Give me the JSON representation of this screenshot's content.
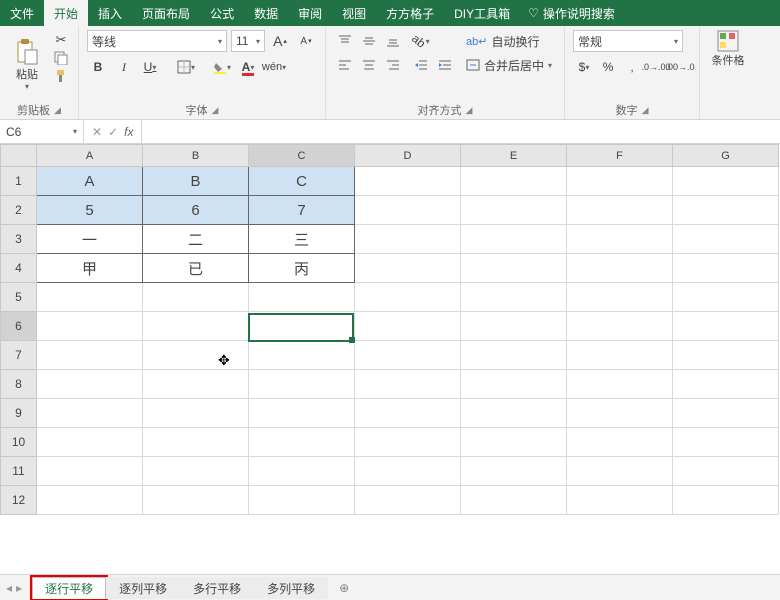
{
  "tabs": {
    "file": "文件",
    "home": "开始",
    "insert": "插入",
    "layout": "页面布局",
    "formulas": "公式",
    "data": "数据",
    "review": "审阅",
    "view": "视图",
    "fanggezi": "方方格子",
    "diy": "DIY工具箱",
    "helpsearch": "操作说明搜索"
  },
  "ribbon": {
    "clipboard": {
      "label": "剪贴板",
      "paste": "粘贴"
    },
    "font": {
      "label": "字体",
      "name": "等线",
      "size": "11",
      "increase": "A",
      "decrease": "A",
      "bold": "B",
      "italic": "I",
      "underline": "U"
    },
    "align": {
      "label": "对齐方式",
      "wrap": "自动换行",
      "merge": "合并后居中"
    },
    "number": {
      "label": "数字",
      "format": "常规"
    },
    "cf": "条件格"
  },
  "namebox": "C6",
  "columns": [
    "A",
    "B",
    "C",
    "D",
    "E",
    "F",
    "G"
  ],
  "rows": [
    1,
    2,
    3,
    4,
    5,
    6,
    7,
    8,
    9,
    10,
    11,
    12
  ],
  "cells": {
    "A1": "A",
    "B1": "B",
    "C1": "C",
    "A2": "5",
    "B2": "6",
    "C2": "7",
    "A3": "一",
    "B3": "二",
    "C3": "三",
    "A4": "甲",
    "B4": "已",
    "C4": "丙"
  },
  "selected_range": [
    "A1",
    "C2"
  ],
  "active_cell": "C6",
  "cursor_at": {
    "row": 7,
    "col": "B"
  },
  "sheet_tabs": {
    "t1": "逐行平移",
    "t2": "逐列平移",
    "t3": "多行平移",
    "t4": "多列平移"
  },
  "active_sheet": "t1",
  "colors": {
    "brand": "#217346",
    "accent": "#e80000",
    "sel": "#cfe2f3"
  }
}
